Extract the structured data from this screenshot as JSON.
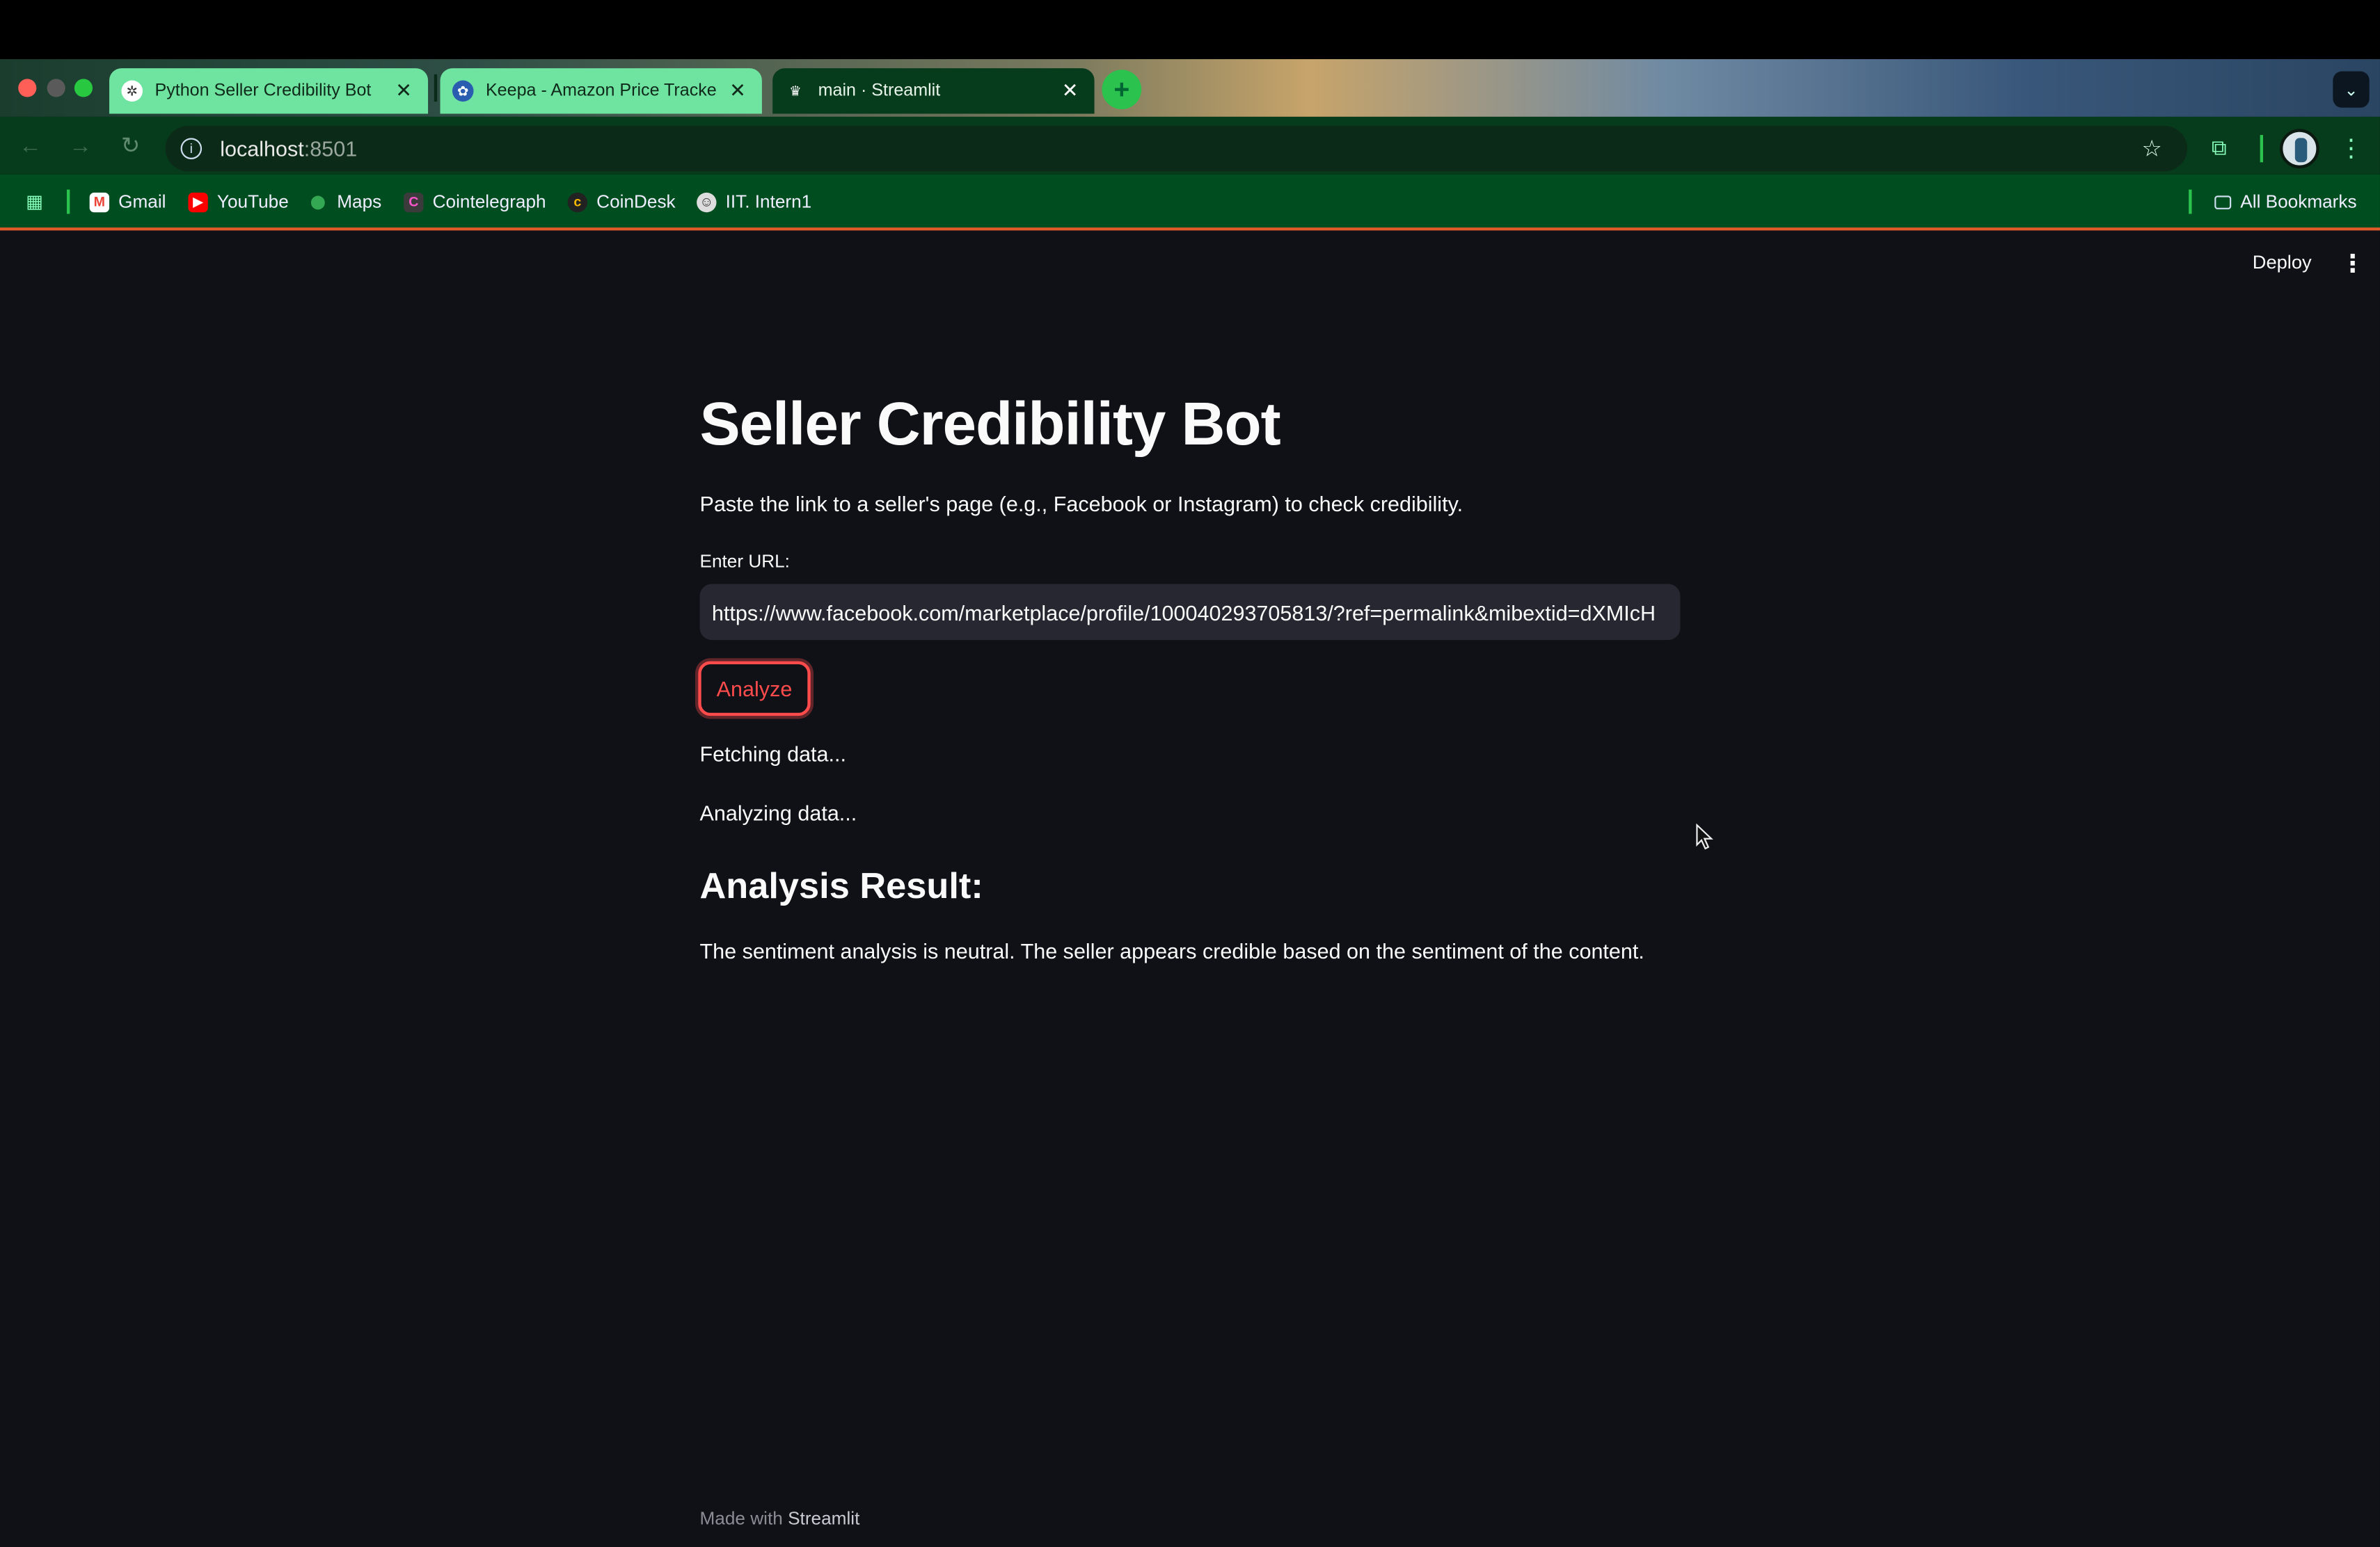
{
  "tabs": [
    {
      "title": "Python Seller Credibility Bot",
      "icon": "openai-icon",
      "active": false
    },
    {
      "title": "Keepa - Amazon Price Tracke",
      "icon": "keepa-icon",
      "active": false
    },
    {
      "title": "main · Streamlit",
      "icon": "streamlit-crown-icon",
      "active": true
    }
  ],
  "address_bar": {
    "host": "localhost",
    "port": ":8501"
  },
  "bookmarks": [
    {
      "label": "Gmail",
      "icon": "gmail-icon",
      "color": "#ea4335"
    },
    {
      "label": "YouTube",
      "icon": "youtube-icon",
      "color": "#ff0000"
    },
    {
      "label": "Maps",
      "icon": "maps-icon",
      "color": "#34a853"
    },
    {
      "label": "Cointelegraph",
      "icon": "cointelegraph-icon",
      "color": "#3b3b3b"
    },
    {
      "label": "CoinDesk",
      "icon": "coindesk-icon",
      "color": "#222222"
    },
    {
      "label": "IIT. Intern1",
      "icon": "intern-icon",
      "color": "#cccccc"
    }
  ],
  "all_bookmarks_label": "All Bookmarks",
  "header": {
    "deploy_label": "Deploy"
  },
  "main": {
    "title": "Seller Credibility Bot",
    "description": "Paste the link to a seller's page (e.g., Facebook or Instagram) to check credibility.",
    "url_label": "Enter URL:",
    "url_value": "https://www.facebook.com/marketplace/profile/100040293705813/?ref=permalink&mibextid=dXMIcH",
    "analyze_label": "Analyze",
    "status_fetching": "Fetching data...",
    "status_analyzing": "Analyzing data...",
    "result_heading": "Analysis Result:",
    "result_text": "The sentiment analysis is neutral. The seller appears credible based on the sentiment of the content."
  },
  "footer": {
    "made_with": "Made with",
    "brand": "Streamlit"
  },
  "colors": {
    "accent": "#ff4b4b",
    "background": "#0f1117",
    "input_bg": "#262730",
    "browser_green": "#004d1f"
  }
}
